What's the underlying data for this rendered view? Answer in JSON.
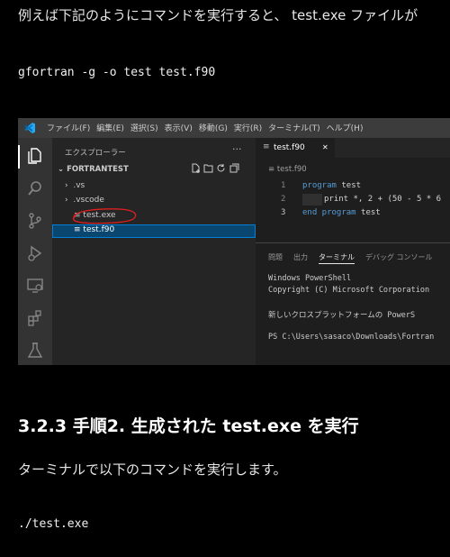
{
  "intro_text": "例えば下記のようにコマンドを実行すると、 test.exe ファイルが",
  "command1": "gfortran -g -o test test.f90",
  "screenshot": {
    "menu": [
      "ファイル(F)",
      "編集(E)",
      "選択(S)",
      "表示(V)",
      "移動(G)",
      "実行(R)",
      "ターミナル(T)",
      "ヘルプ(H)"
    ],
    "explorer_title": "エクスプローラー",
    "explorer_more": "···",
    "folder": "FORTRANTEST",
    "tree": [
      {
        "label": ".vs",
        "chev": "›"
      },
      {
        "label": ".vscode",
        "chev": "›"
      },
      {
        "label": "test.exe",
        "chev": "≡"
      },
      {
        "label": "test.f90",
        "chev": "≡"
      }
    ],
    "tab_label": "test.f90",
    "tab_close": "✕",
    "breadcrumb": "test.f90",
    "line_numbers": [
      "1",
      "2",
      "3"
    ],
    "code": {
      "l1_kw": "program",
      "l1_rest": " test",
      "l2": "print *, 2 + (50 - 5 * 6",
      "l3_kw": "end program",
      "l3_rest": " test"
    },
    "panel_tabs": [
      "問題",
      "出力",
      "ターミナル",
      "デバッグ コンソール"
    ],
    "terminal": [
      "Windows PowerShell",
      "Copyright (C) Microsoft Corporation",
      "",
      "新しいクロスプラットフォームの PowerS",
      "",
      "PS C:\\Users\\sasaco\\Downloads\\Fortran"
    ]
  },
  "heading": "3.2.3 手順2. 生成された test.exe を実行",
  "paragraph": "ターミナルで以下のコマンドを実行します。",
  "command2": "./test.exe",
  "colors": {
    "accent": "#007acc",
    "selection": "#094771",
    "annotation": "#e02020"
  }
}
